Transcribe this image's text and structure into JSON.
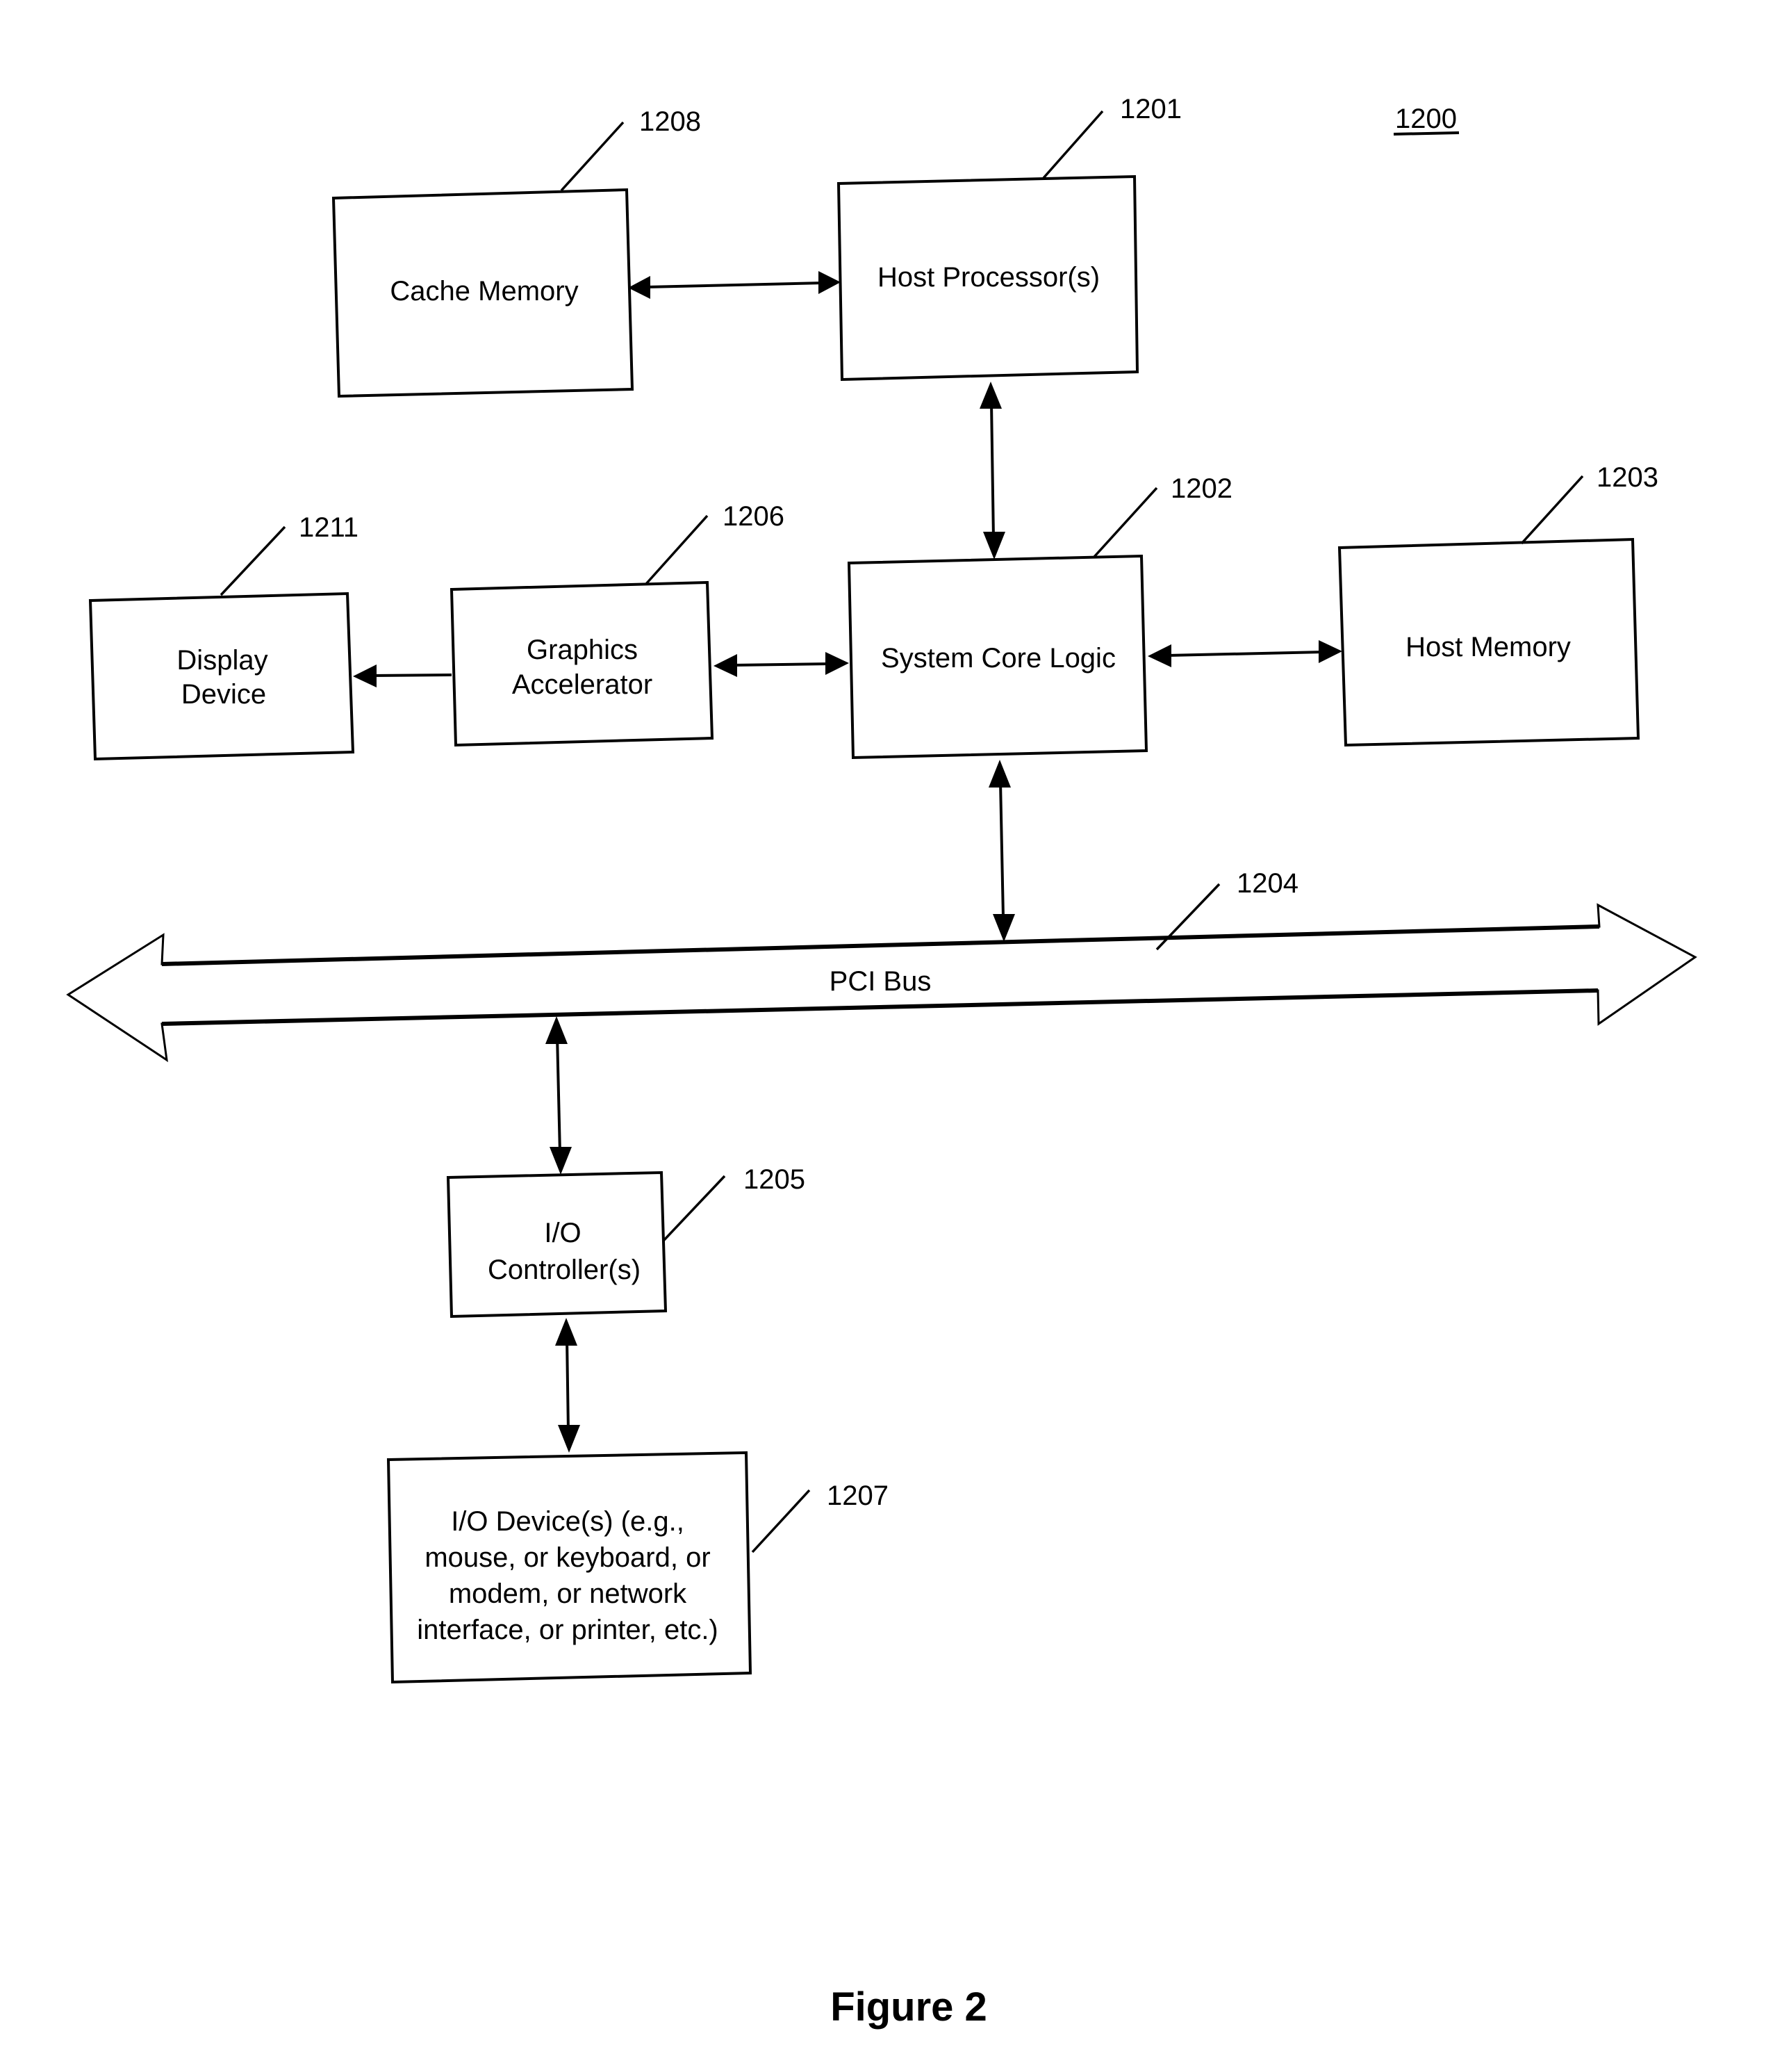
{
  "figure": {
    "number": "1200",
    "caption": "Figure 2"
  },
  "blocks": {
    "cache_memory": {
      "ref": "1208",
      "lines": [
        "Cache Memory"
      ]
    },
    "host_processor": {
      "ref": "1201",
      "lines": [
        "Host Processor(s)"
      ]
    },
    "system_core_logic": {
      "ref": "1202",
      "lines": [
        "System Core Logic"
      ]
    },
    "host_memory": {
      "ref": "1203",
      "lines": [
        "Host Memory"
      ]
    },
    "graphics_accelerator": {
      "ref": "1206",
      "lines": [
        "Graphics",
        "Accelerator"
      ]
    },
    "display_device": {
      "ref": "1211",
      "lines": [
        "Display",
        "Device"
      ]
    },
    "pci_bus": {
      "ref": "1204",
      "lines": [
        "PCI Bus"
      ]
    },
    "io_controller": {
      "ref": "1205",
      "lines": [
        "I/O",
        "Controller(s)"
      ]
    },
    "io_device": {
      "ref": "1207",
      "lines": [
        "I/O Device(s) (e.g.,",
        "mouse, or keyboard, or",
        "modem, or network",
        "interface, or printer, etc.)"
      ]
    }
  },
  "connections": [
    {
      "from": "cache_memory",
      "to": "host_processor",
      "type": "bidirectional"
    },
    {
      "from": "host_processor",
      "to": "system_core_logic",
      "type": "bidirectional"
    },
    {
      "from": "system_core_logic",
      "to": "host_memory",
      "type": "bidirectional"
    },
    {
      "from": "graphics_accelerator",
      "to": "system_core_logic",
      "type": "bidirectional"
    },
    {
      "from": "graphics_accelerator",
      "to": "display_device",
      "type": "unidirectional"
    },
    {
      "from": "system_core_logic",
      "to": "pci_bus",
      "type": "bidirectional"
    },
    {
      "from": "pci_bus",
      "to": "io_controller",
      "type": "bidirectional"
    },
    {
      "from": "io_controller",
      "to": "io_device",
      "type": "bidirectional"
    }
  ]
}
